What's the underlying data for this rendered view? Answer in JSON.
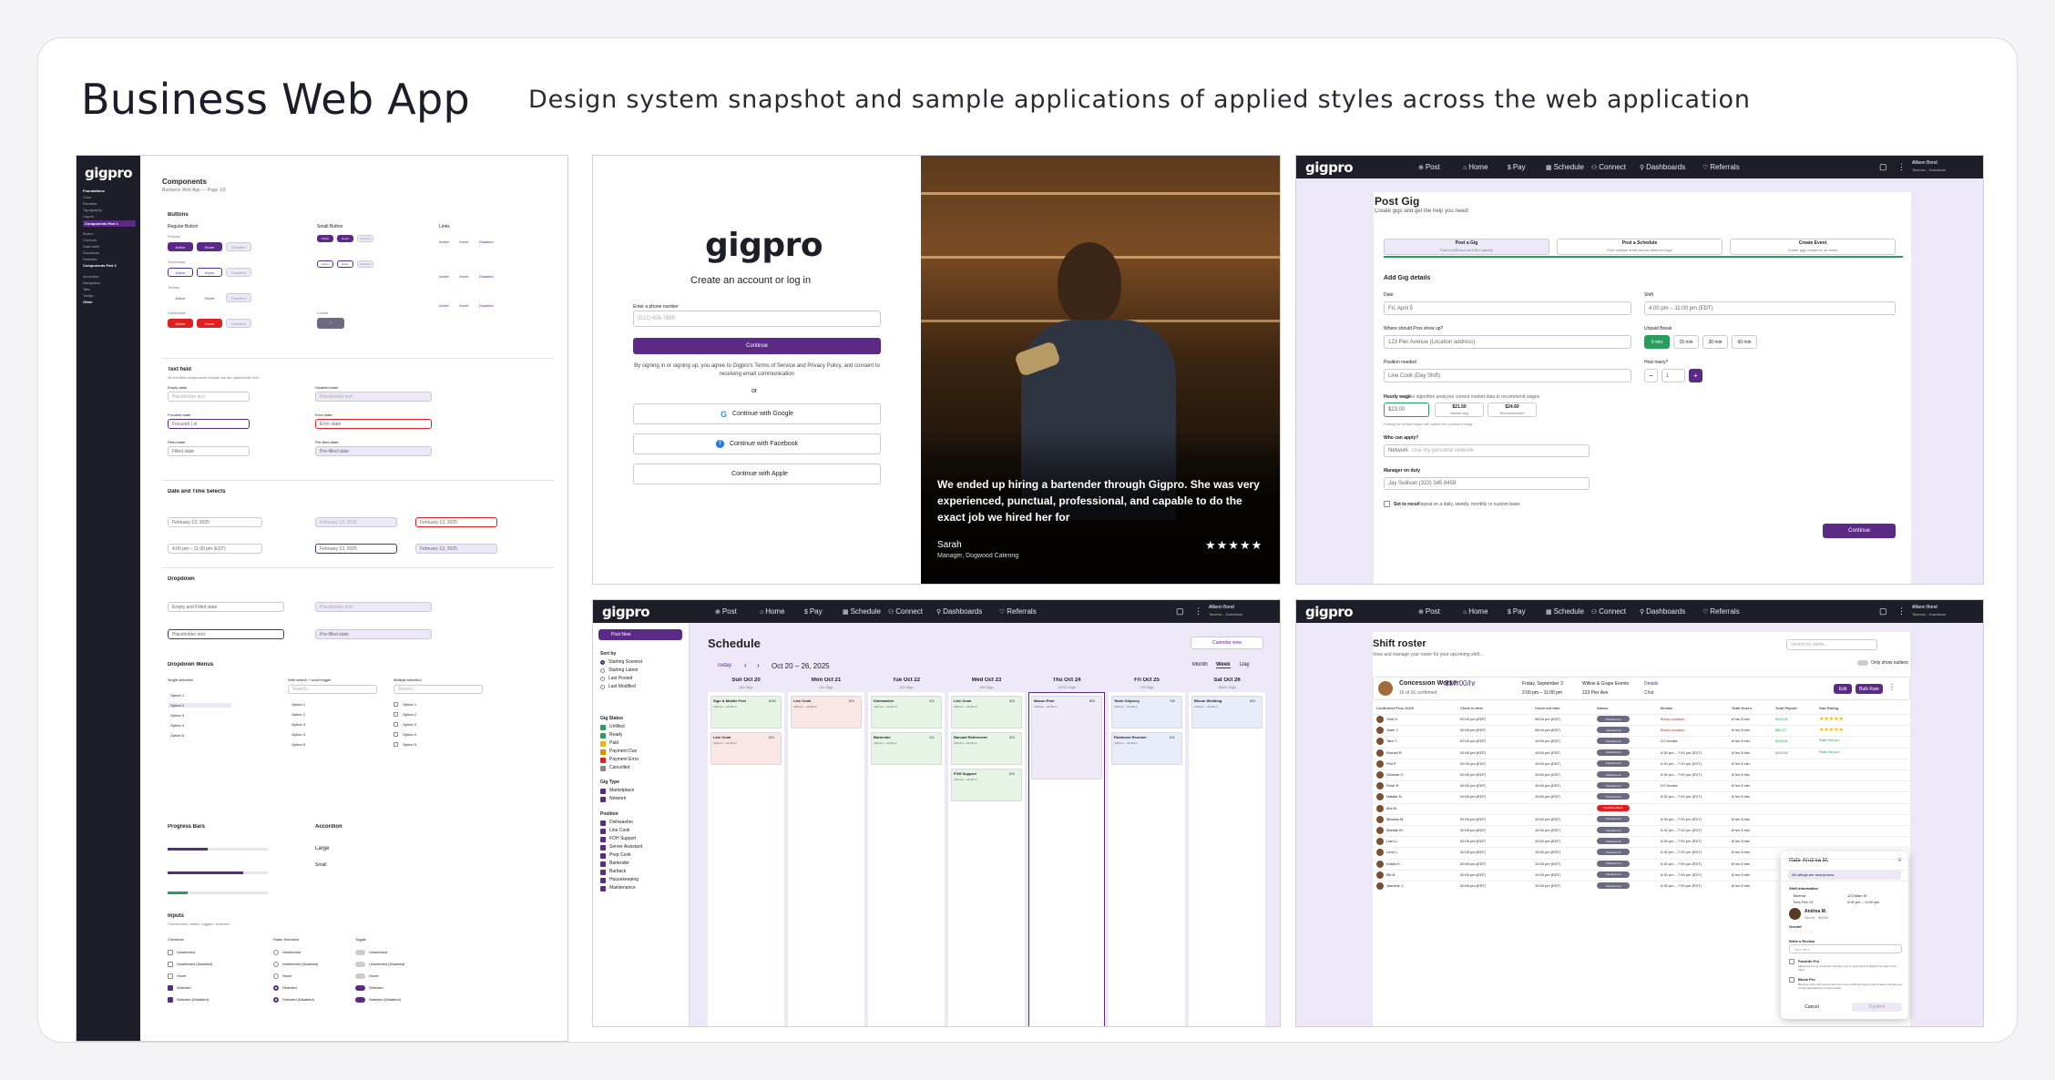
{
  "header": {
    "title": "Business Web App",
    "subtitle": "Design system snapshot and sample applications of applied styles across the web application"
  },
  "colors": {
    "brand": "#5b2a86",
    "nav": "#1e1e28",
    "lavender": "#ece8f8",
    "danger": "#e02020"
  },
  "logo": "gigpro",
  "components": {
    "sidebar_sections": [
      "Foundations",
      "Color",
      "Elevation",
      "Typography",
      "Layout",
      "Components Part 1",
      "Button",
      "Controls",
      "Data table",
      "Dropdown",
      "Selection",
      "Components Part 2",
      "Accordion",
      "Navigation",
      "Tabs",
      "Tooltip",
      "Other"
    ],
    "title": "Components",
    "subtitle": "Business Web App — Page 1/3",
    "buttons_heading": "Buttons",
    "regular_button": "Regular Button",
    "small_button": "Small Button",
    "links": "Links",
    "primary": "Primary",
    "secondary": "Secondary",
    "tertiary": "Tertiary",
    "destructive": "Destructive",
    "loader": "Loader",
    "btn_labels": [
      "Active",
      "Hover",
      "Disabled"
    ],
    "textfield_heading": "Text field",
    "textfield_desc": "All text field components should use the placeholder text",
    "empty_state": "Empty state",
    "disabled_state": "Disabled state",
    "focused_state": "Focused state",
    "error_state": "Error state",
    "filled_state": "Filled state",
    "prefilled_state": "Pre-filled state",
    "placeholder": "Placeholder text",
    "focused_val": "Focused | st",
    "error_val": "Error state",
    "filled_val": "Filled state",
    "prefilled_val": "Pre-filled state",
    "date_heading": "Date and Time Selects",
    "date_val": "February 13, 2025",
    "shift_val": "4:00 pm – 11:00 pm (EDT)",
    "dropdown_heading": "Dropdown",
    "dropdown_val": "Empty and Filled state",
    "dropdown_menus": "Dropdown Menus",
    "single_selection": "Single selection",
    "with_search": "With search + scroll trigger",
    "multiple_selection": "Multiple selection",
    "options": [
      "Option 1",
      "Option 2",
      "Option 3",
      "Option 4",
      "Option 5"
    ],
    "search_ph": "Search...",
    "progress_heading": "Progress Bars",
    "accordion_heading": "Accordion",
    "accordion_items": [
      "Large",
      "Small"
    ],
    "inputs_heading": "Inputs",
    "inputs_desc": "Checkboxes, radios, toggles, selectors",
    "checkbox": "Checkbox",
    "radio_selection": "Radio Selection",
    "toggle": "Toggle",
    "input_states": [
      "Unselected",
      "Unselected (Disabled)",
      "Hover",
      "Selected",
      "Selected (Disabled)"
    ]
  },
  "login": {
    "title": "Create an account or log in",
    "phone_label": "Enter a phone number",
    "phone_placeholder": "(512) 456-7890",
    "continue": "Continue",
    "terms": "By signing in or signing up, you agree to Gigpro's Terms of Service and Privacy Policy, and consent to receiving email communication",
    "or": "or",
    "google": "Continue with Google",
    "facebook": "Continue with Facebook",
    "apple": "Continue with Apple",
    "quote": "We ended up hiring a bartender through Gigpro. She was very experienced, punctual, professional, and capable to do the exact job we hired her for",
    "author": "Sarah",
    "author_title": "Manager, Dogwood Catering",
    "rating": "★★★★★"
  },
  "nav": {
    "items": [
      "Post",
      "Home",
      "Pay",
      "Schedule",
      "Connect",
      "Dashboards",
      "Referrals"
    ],
    "user": "Allison Bond",
    "user_sub": "Taverna – Downtown"
  },
  "post_gig": {
    "title": "Post Gig",
    "subtitle": "Create gigs and get the help you need!",
    "tabs": [
      {
        "title": "Post a Gig",
        "desc": "Post a shift and we'll fill it quickly"
      },
      {
        "title": "Post a Schedule",
        "desc": "Post multiple shifts across different days"
      },
      {
        "title": "Create Event",
        "desc": "Create gigs related to an event"
      }
    ],
    "section": "Add Gig details",
    "date_label": "Date",
    "date_val": "Fri, April 5",
    "shift_label": "Shift",
    "shift_val": "4:00 pm – 11:00 pm (EDT)",
    "where_label": "Where should Pros show up?",
    "where_val": "123 Pier Avenue (Location address)",
    "break_label": "Unpaid Break",
    "break_opts": [
      "0 min",
      "15 min",
      "30 min",
      "60 min"
    ],
    "position_label": "Position needed",
    "position_val": "Line Cook (Day Shift)",
    "howmany_label": "How many?",
    "howmany_val": "1",
    "wage_label": "Hourly wage",
    "wage_desc": "Our algorithm analyzes current market data to recommend wages",
    "wage_val": "$23.00",
    "wage_opts": [
      {
        "v": "$21.50",
        "l": "Market avg"
      },
      {
        "v": "$24.60",
        "l": "Recommended"
      }
    ],
    "wage_note": "Editing the default wage will update the position's wage",
    "who_label": "Who can apply?",
    "who_val": "Network",
    "who_hint": "Use my personal network",
    "manager_label": "Manager on duty",
    "manager_val": "Jay Sullivan (323) 345 8459",
    "recur_label": "Set to recur",
    "recur_desc": "Repeat on a daily, weekly, monthly or custom basis",
    "continue": "Continue"
  },
  "schedule": {
    "post_new": "Post New",
    "title": "Schedule",
    "today": "Today",
    "range": "Oct 20 – 26, 2025",
    "calendar_view": "Calendar view",
    "views": [
      "Month",
      "Week",
      "Day"
    ],
    "sort_by": "Sort by",
    "sort_opts": [
      "Starting Soonest",
      "Starting Latest",
      "Last Posted",
      "Last Modified"
    ],
    "gig_status": "Gig Status",
    "status_opts": [
      "Unfilled",
      "Ready",
      "Paid",
      "Payment Due",
      "Payment Error",
      "Cancelled"
    ],
    "gig_type": "Gig Type",
    "type_opts": [
      "Marketplace",
      "Network"
    ],
    "position": "Position",
    "position_opts": [
      "Dishwasher",
      "Line Cook",
      "FOH Support",
      "Server Assistant",
      "Prep Cook",
      "Bartender",
      "Barback",
      "Housekeeping",
      "Maintenance"
    ],
    "days": [
      {
        "name": "Sun Oct 20",
        "gigs": "3/3 Gigs"
      },
      {
        "name": "Mon Oct 21",
        "gigs": "0/1 Gigs"
      },
      {
        "name": "Tue Oct 22",
        "gigs": "3/3 Gigs"
      },
      {
        "name": "Wed Oct 23",
        "gigs": "5/9 Gigs"
      },
      {
        "name": "Thu Oct 24",
        "gigs": "12/12 Gigs"
      },
      {
        "name": "Fri Oct 25",
        "gigs": "7/9 Gigs"
      },
      {
        "name": "Sat Oct 26",
        "gigs": "18/22 Gigs"
      }
    ],
    "cards": [
      {
        "day": 0,
        "title": "Sign & Mobile Fest",
        "count": "9/10",
        "time": "4:00 pm – 11:00 pm",
        "color": "#e6f4e6"
      },
      {
        "day": 0,
        "title": "Line Cook",
        "count": "0/3",
        "time": "4:00 pm – 11:00 pm",
        "color": "#fbe6e6"
      },
      {
        "day": 1,
        "title": "Line Cook",
        "count": "0/1",
        "time": "4:00 pm – 11:00 pm",
        "color": "#fbe6e6"
      },
      {
        "day": 2,
        "title": "Dishwasher",
        "count": "1/1",
        "time": "4:00 pm – 11:00 pm",
        "color": "#e6f4e6"
      },
      {
        "day": 2,
        "title": "Bartender",
        "count": "1/1",
        "time": "4:00 pm – 11:00 pm",
        "color": "#e6f4e6"
      },
      {
        "day": 3,
        "title": "Line Cook",
        "count": "3/3",
        "time": "4:00 pm – 11:00 pm",
        "color": "#e6f4e6"
      },
      {
        "day": 3,
        "title": "Barcadi Retirement",
        "count": "3/3",
        "time": "4:00 pm – 11:00 pm",
        "color": "#e6f4e6"
      },
      {
        "day": 3,
        "title": "FOH Support",
        "count": "0/3",
        "time": "4:00 pm – 11:00 pm",
        "color": "#e6f4e6"
      },
      {
        "day": 4,
        "title": "Mason Park",
        "count": "9/9",
        "time": "4:00 pm – 11:00 pm",
        "color": "#eeeaf8"
      },
      {
        "day": 5,
        "title": "Taste Odyssey",
        "count": "7/8",
        "time": "4:00 pm – 11:00 pm",
        "color": "#e8ecf8"
      },
      {
        "day": 5,
        "title": "Robinson Reunion",
        "count": "0/1",
        "time": "4:00 pm – 11:00 pm",
        "color": "#e8ecf8"
      },
      {
        "day": 6,
        "title": "Bloom Wedding",
        "count": "9/9",
        "time": "4:00 pm – 11:00 pm",
        "color": "#e8ecf8"
      }
    ]
  },
  "roster": {
    "title": "Shift roster",
    "subtitle": "View and manage your roster for your upcoming shift...",
    "search_ph": "Search by name...",
    "only_show": "Only show outliers",
    "role": "Concession Worker",
    "rate": "$17.00/hr",
    "confirmed": "16 of 16 confirmed",
    "date": "Friday, September 3",
    "time": "2:00 pm – 11:00 pm",
    "venue": "Willow & Grape Events",
    "address": "123 Pier Ave",
    "details": "Details",
    "chat": "Chat",
    "edit": "Edit",
    "bulk_rate": "Bulk Rate",
    "columns": [
      "Confirmed Pros 16/16",
      "Clock in time",
      "Clock out time",
      "Status",
      "Breaks",
      "Total Hours",
      "Total Payout",
      "Star Rating"
    ],
    "rows": [
      {
        "name": "Vicki V.",
        "in": "02:00 pm (EDT)",
        "out": "08:04 pm (EDT)",
        "status": "Checked out",
        "brk": "Break violation",
        "hrs": "6 hrs 3 min",
        "pay": "$103.00",
        "rate": "★★★★★"
      },
      {
        "name": "Josie J.",
        "in": "02:00 pm (EDT)",
        "out": "08:04 pm (EDT)",
        "status": "Checked out",
        "brk": "Break violation",
        "hrs": "6 hrs 3 min",
        "pay": "$85.37",
        "rate": "★★★★★"
      },
      {
        "name": "Tara T.",
        "in": "02:00 pm (EDT)",
        "out": "10:00 pm (EDT)",
        "status": "Checked out",
        "brk": "2/2 breaks",
        "hrs": "8 hrs 3 min",
        "pay": "$153.60",
        "rate": "Rate this pro"
      },
      {
        "name": "Ronald R.",
        "in": "02:00 pm (EDT)",
        "out": "10:00 pm (EDT)",
        "status": "Checked out",
        "brk": "6:30 pm – 7:00 pm (EDT)",
        "hrs": "8 hrs 3 min",
        "pay": "$153.60",
        "rate": "Rate this pro"
      },
      {
        "name": "Phil P.",
        "in": "02:00 pm (EDT)",
        "out": "10:00 pm (EDT)",
        "status": "Checked out",
        "brk": "6:30 pm – 7:00 pm (EDT)",
        "hrs": "8 hrs 3 min",
        "pay": "",
        "rate": ""
      },
      {
        "name": "Orlando O.",
        "in": "02:00 pm (EDT)",
        "out": "10:00 pm (EDT)",
        "status": "Checked out",
        "brk": "6:30 pm – 7:00 pm (EDT)",
        "hrs": "8 hrs 3 min",
        "pay": "",
        "rate": ""
      },
      {
        "name": "Rush R.",
        "in": "02:00 pm (EDT)",
        "out": "10:00 pm (EDT)",
        "status": "Checked out",
        "brk": "2/2 breaks",
        "hrs": "8 hrs 3 min",
        "pay": "",
        "rate": ""
      },
      {
        "name": "Natalie N.",
        "in": "02:00 pm (EDT)",
        "out": "10:00 pm (EDT)",
        "status": "Checked out",
        "brk": "6:30 pm – 7:00 pm (EDT)",
        "hrs": "8 hrs 3 min",
        "pay": "",
        "rate": ""
      },
      {
        "name": "Mol M.",
        "in": "",
        "out": "",
        "status": "No Show (Flex)",
        "brk": "",
        "hrs": "",
        "pay": "",
        "rate": ""
      },
      {
        "name": "Micaela M.",
        "in": "02:00 pm (EDT)",
        "out": "10:00 pm (EDT)",
        "status": "Checked out",
        "brk": "6:30 pm – 7:00 pm (EDT)",
        "hrs": "8 hrs 3 min",
        "pay": "",
        "rate": ""
      },
      {
        "name": "Maddie M.",
        "in": "02:00 pm (EDT)",
        "out": "10:00 pm (EDT)",
        "status": "Checked out",
        "brk": "6:30 pm – 7:00 pm (EDT)",
        "hrs": "8 hrs 3 min",
        "pay": "",
        "rate": ""
      },
      {
        "name": "Liam L.",
        "in": "02:00 pm (EDT)",
        "out": "10:00 pm (EDT)",
        "status": "Checked out",
        "brk": "6:30 pm – 7:00 pm (EDT)",
        "hrs": "8 hrs 3 min",
        "pay": "",
        "rate": ""
      },
      {
        "name": "Leon L.",
        "in": "02:00 pm (EDT)",
        "out": "10:00 pm (EDT)",
        "status": "Checked out",
        "brk": "6:30 pm – 7:00 pm (EDT)",
        "hrs": "8 hrs 3 min",
        "pay": "",
        "rate": ""
      },
      {
        "name": "Kristin K.",
        "in": "02:00 pm (EDT)",
        "out": "10:00 pm (EDT)",
        "status": "Checked out",
        "brk": "6:30 pm – 7:00 pm (EDT)",
        "hrs": "8 hrs 3 min",
        "pay": "",
        "rate": ""
      },
      {
        "name": "Bill B.",
        "in": "02:00 pm (EDT)",
        "out": "10:00 pm (EDT)",
        "status": "Checked out",
        "brk": "6:30 pm – 7:00 pm (EDT)",
        "hrs": "8 hrs 3 min",
        "pay": "",
        "rate": ""
      },
      {
        "name": "Jasmine J.",
        "in": "02:00 pm (EDT)",
        "out": "10:00 pm (EDT)",
        "status": "Checked out",
        "brk": "6:30 pm – 7:00 pm (EDT)",
        "hrs": "8 hrs 3 min",
        "pay": "",
        "rate": ""
      }
    ],
    "modal": {
      "title": "Rate Andrea M.",
      "anon": "All ratings are anonymous.",
      "shift_info": "Shift Information",
      "venue": "Taverna",
      "date": "Tues Feb 13",
      "role": "123 Main St",
      "time": "4:00 pm – 11:00 pm",
      "pro_name": "Andrea M.",
      "pro_sub": "Server · $20/hr",
      "overall": "Overall",
      "review": "Write a Review",
      "review_ph": "Type here",
      "fav": "Favorite Pro",
      "fav_desc": "Marking a Pro as a Favorite will allow you to send direct invitations for Gigs in the future",
      "block": "Block Pro",
      "block_desc": "Blocking a Pro will remove them from any confirmed Gigs at this location and hide any of their applications moving forward",
      "cancel": "Cancel",
      "confirm": "Confirm"
    }
  }
}
